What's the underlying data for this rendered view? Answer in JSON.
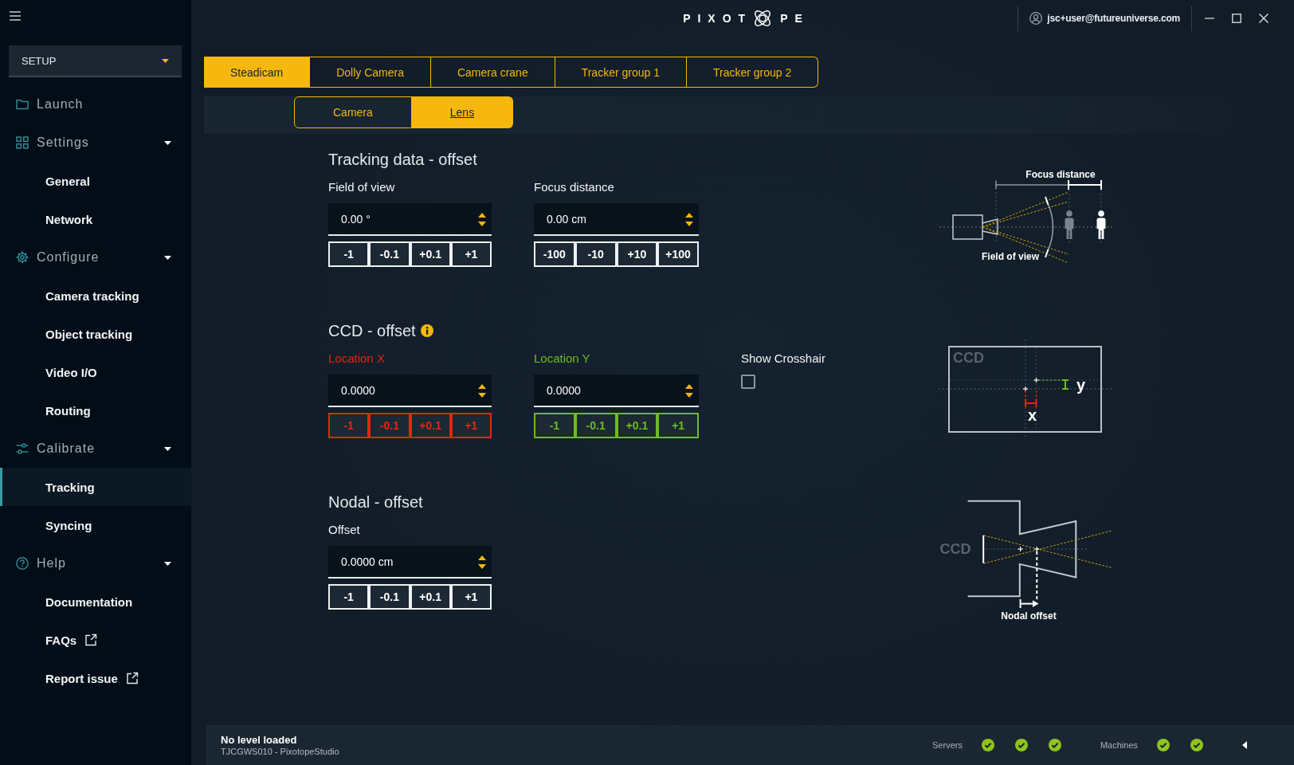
{
  "header": {
    "logo": {
      "before_mark": "PIXOT",
      "after_mark": "PE"
    },
    "user": {
      "email": "jsc+user@futureuniverse.com"
    }
  },
  "sidebar": {
    "mode_dropdown": {
      "value": "SETUP"
    },
    "items": [
      {
        "kind": "link",
        "label": "Launch"
      },
      {
        "kind": "group",
        "label": "Settings",
        "expanded": true,
        "children": [
          {
            "label": "General",
            "selected": false,
            "external": false
          },
          {
            "label": "Network",
            "selected": false,
            "external": false
          }
        ]
      },
      {
        "kind": "group",
        "label": "Configure",
        "expanded": true,
        "children": [
          {
            "label": "Camera tracking",
            "selected": false,
            "external": false
          },
          {
            "label": "Object tracking",
            "selected": false,
            "external": false
          },
          {
            "label": "Video I/O",
            "selected": false,
            "external": false
          },
          {
            "label": "Routing",
            "selected": false,
            "external": false
          }
        ]
      },
      {
        "kind": "group",
        "label": "Calibrate",
        "expanded": true,
        "children": [
          {
            "label": "Tracking",
            "selected": true,
            "external": false
          },
          {
            "label": "Syncing",
            "selected": false,
            "external": false
          }
        ]
      },
      {
        "kind": "group",
        "label": "Help",
        "expanded": true,
        "children": [
          {
            "label": "Documentation",
            "selected": false,
            "external": false
          },
          {
            "label": "FAQs",
            "selected": false,
            "external": true
          },
          {
            "label": "Report issue",
            "selected": false,
            "external": true
          }
        ]
      }
    ]
  },
  "tabs": [
    {
      "label": "Steadicam",
      "selected": true
    },
    {
      "label": "Dolly Camera",
      "selected": false
    },
    {
      "label": "Camera crane",
      "selected": false
    },
    {
      "label": "Tracker group 1",
      "selected": false
    },
    {
      "label": "Tracker group 2",
      "selected": false
    }
  ],
  "subtabs": [
    {
      "label": "Camera",
      "selected": false
    },
    {
      "label": "Lens",
      "selected": true
    }
  ],
  "sections": [
    {
      "title": "Tracking data - offset",
      "fields": [
        {
          "kind": "number",
          "label": "Field of view",
          "value": "0.00 °",
          "steps": [
            "-1",
            "-0.1",
            "+0.1",
            "+1"
          ]
        },
        {
          "kind": "number",
          "label": "Focus distance",
          "value": "0.00 cm",
          "steps": [
            "-100",
            "-10",
            "+10",
            "+100"
          ]
        }
      ],
      "diagram": {
        "kind": "fov",
        "focus_label": "Focus distance",
        "fov_label": "Field of view"
      }
    },
    {
      "title": "CCD - offset",
      "info": true,
      "fields": [
        {
          "kind": "number",
          "label": "Location X",
          "color": "#ea2310",
          "value": "0.0000",
          "steps": [
            "-1",
            "-0.1",
            "+0.1",
            "+1"
          ]
        },
        {
          "kind": "number",
          "label": "Location Y",
          "color": "#6dbd1e",
          "value": "0.0000",
          "steps": [
            "-1",
            "-0.1",
            "+0.1",
            "+1"
          ]
        },
        {
          "kind": "checkbox",
          "label": "Show Crosshair",
          "checked": false
        }
      ],
      "diagram": {
        "kind": "ccd",
        "sensor_label": "CCD",
        "y_label": "y",
        "x_label": "x"
      }
    },
    {
      "title": "Nodal - offset",
      "fields": [
        {
          "kind": "number",
          "label": "Offset",
          "value": "0.0000 cm",
          "steps": [
            "-1",
            "-0.1",
            "+0.1",
            "+1"
          ]
        }
      ],
      "diagram": {
        "kind": "nodal",
        "sensor_label": "CCD",
        "offset_label": "Nodal offset"
      }
    }
  ],
  "status_bar": {
    "title": "No level loaded",
    "subtitle": "TJCGWS010 - PixotopeStudio",
    "groups": [
      {
        "label": "Servers",
        "indicators": [
          {
            "ok": true
          },
          {
            "ok": true
          },
          {
            "ok": true
          }
        ]
      },
      {
        "label": "Machines",
        "indicators": [
          {
            "ok": true
          },
          {
            "ok": true
          }
        ]
      }
    ]
  }
}
